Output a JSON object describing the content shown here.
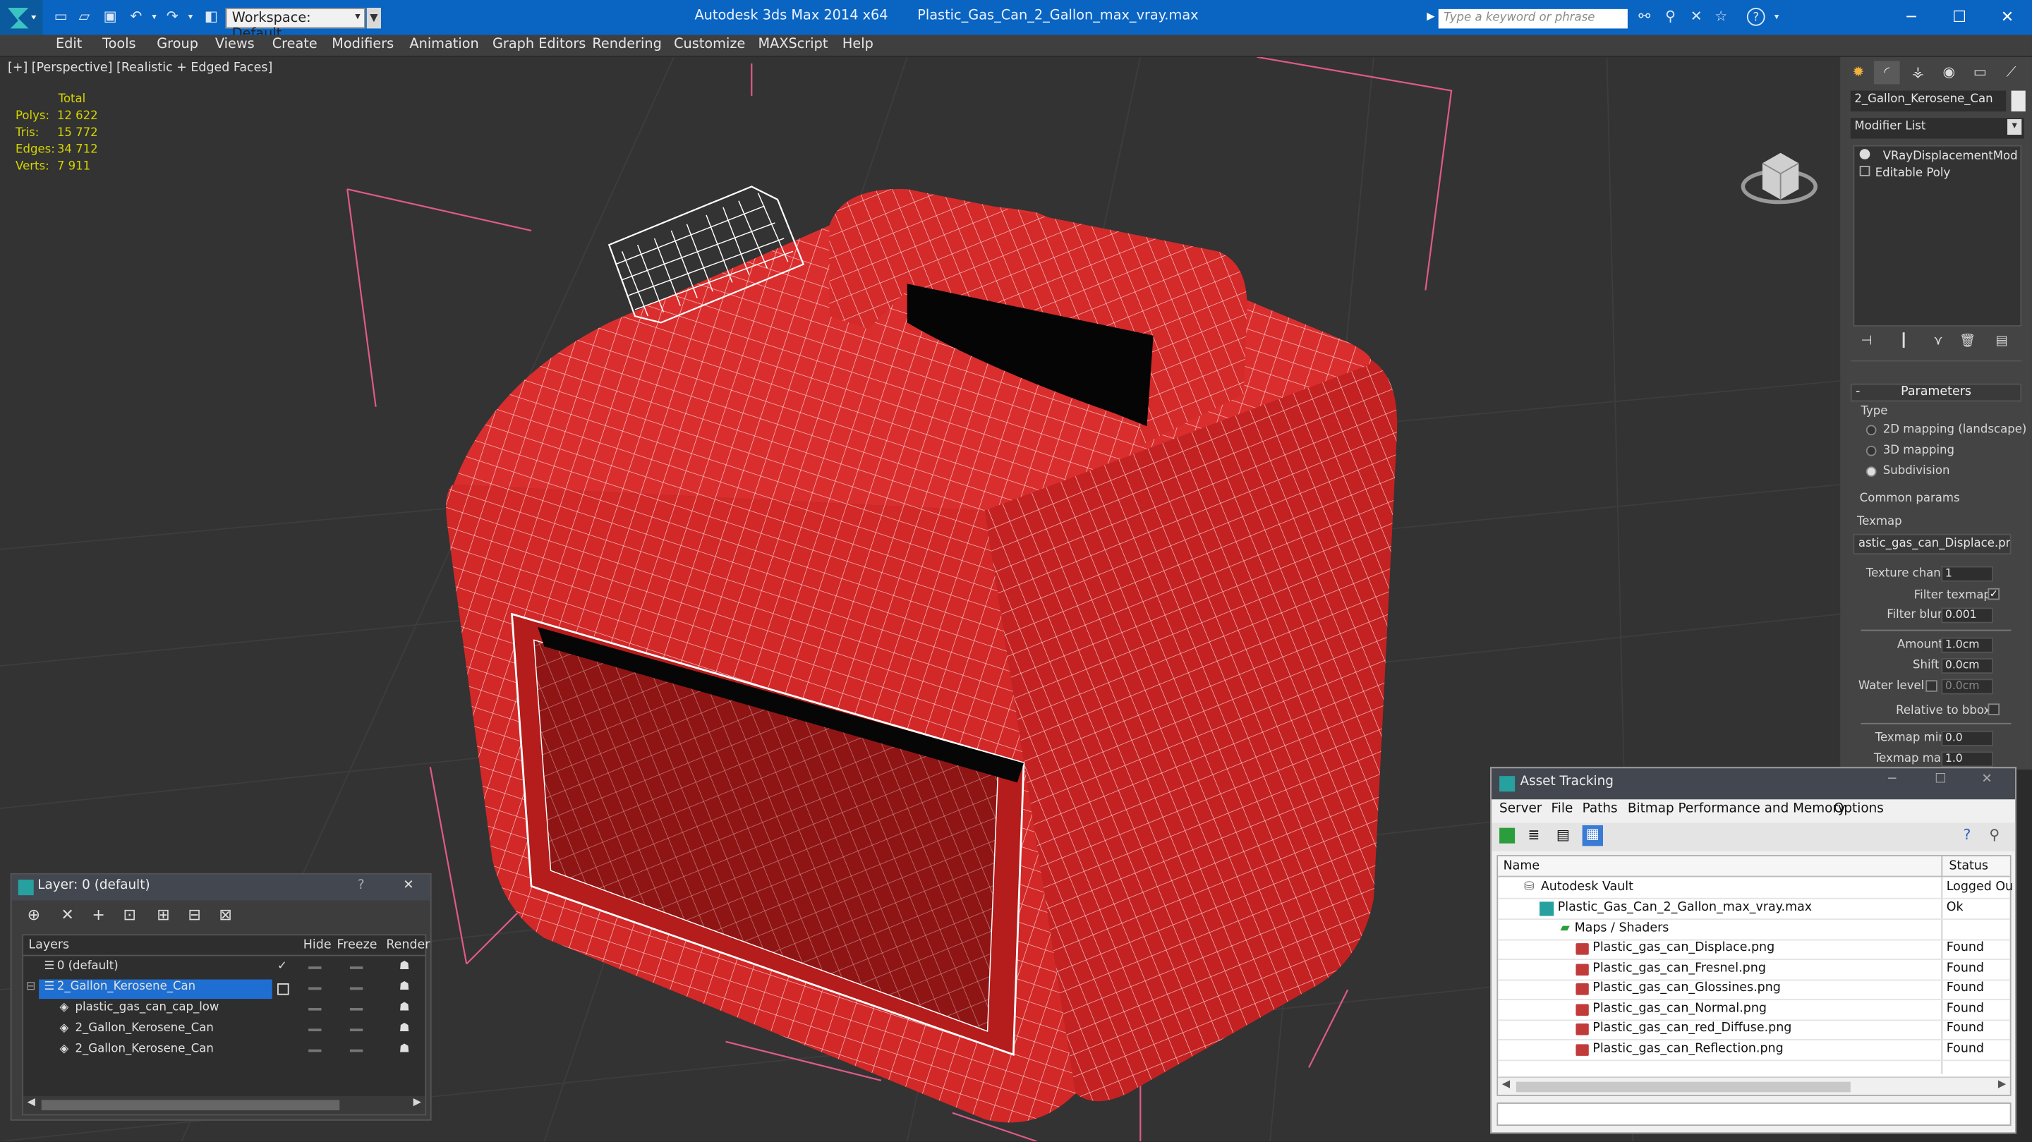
{
  "app": {
    "title": "Autodesk 3ds Max  2014 x64",
    "filename": "Plastic_Gas_Can_2_Gallon_max_vray.max",
    "workspace": "Workspace: Default",
    "search_placeholder": "Type a keyword or phrase"
  },
  "menu": [
    "Edit",
    "Tools",
    "Group",
    "Views",
    "Create",
    "Modifiers",
    "Animation",
    "Graph Editors",
    "Rendering",
    "Customize",
    "MAXScript",
    "Help"
  ],
  "viewport": {
    "label": "[+] [Perspective] [Realistic + Edged Faces]",
    "stats_header": "Total",
    "stats": [
      {
        "label": "Polys:",
        "value": "12 622"
      },
      {
        "label": "Tris:",
        "value": "15 772"
      },
      {
        "label": "Edges:",
        "value": "34 712"
      },
      {
        "label": "Verts:",
        "value": "7 911"
      }
    ]
  },
  "command_panel": {
    "object_name": "2_Gallon_Kerosene_Can",
    "modifier_list": "Modifier List",
    "stack": [
      "VRayDisplacementMod",
      "Editable Poly"
    ],
    "parameters_title": "Parameters",
    "type_label": "Type",
    "type_options": [
      "2D mapping (landscape)",
      "3D mapping",
      "Subdivision"
    ],
    "type_selected": 2,
    "common_params": "Common params",
    "texmap_label": "Texmap",
    "texmap_value": "astic_gas_can_Displace.png)",
    "texture_chan_label": "Texture chan",
    "texture_chan": "1",
    "filter_texmap_label": "Filter texmap",
    "filter_blur_label": "Filter blur",
    "filter_blur": "0.001",
    "amount_label": "Amount",
    "amount": "1.0cm",
    "shift_label": "Shift",
    "shift": "0.0cm",
    "water_level_label": "Water level",
    "water_level": "0.0cm",
    "relative_bbox_label": "Relative to bbox",
    "texmap_min_label": "Texmap min",
    "texmap_min": "0.0",
    "texmap_max_label": "Texmap max",
    "texmap_max": "1.0"
  },
  "layer_dialog": {
    "title": "Layer: 0 (default)",
    "help": "?",
    "close": "✕",
    "columns": [
      "Layers",
      "Hide",
      "Freeze",
      "Render"
    ],
    "rows": [
      {
        "name": "0 (default)",
        "indent": 0
      },
      {
        "name": "2_Gallon_Kerosene_Can",
        "indent": 0
      },
      {
        "name": "plastic_gas_can_cap_low",
        "indent": 1
      },
      {
        "name": "2_Gallon_Kerosene_Can",
        "indent": 1
      },
      {
        "name": "2_Gallon_Kerosene_Can",
        "indent": 1
      }
    ]
  },
  "asset_tracking": {
    "title": "Asset Tracking",
    "menu": [
      "Server",
      "File",
      "Paths",
      "Bitmap Performance and Memory",
      "Options"
    ],
    "columns": [
      "Name",
      "Status"
    ],
    "rows": [
      {
        "name": "Autodesk Vault",
        "status": "Logged Ou",
        "level": 0,
        "kind": "vault"
      },
      {
        "name": "Plastic_Gas_Can_2_Gallon_max_vray.max",
        "status": "Ok",
        "level": 1,
        "kind": "max"
      },
      {
        "name": "Maps / Shaders",
        "status": "",
        "level": 2,
        "kind": "folder"
      },
      {
        "name": "Plastic_gas_can_Displace.png",
        "status": "Found",
        "level": 3,
        "kind": "png"
      },
      {
        "name": "Plastic_gas_can_Fresnel.png",
        "status": "Found",
        "level": 3,
        "kind": "png"
      },
      {
        "name": "Plastic_gas_can_Glossines.png",
        "status": "Found",
        "level": 3,
        "kind": "png"
      },
      {
        "name": "Plastic_gas_can_Normal.png",
        "status": "Found",
        "level": 3,
        "kind": "png"
      },
      {
        "name": "Plastic_gas_can_red_Diffuse.png",
        "status": "Found",
        "level": 3,
        "kind": "png"
      },
      {
        "name": "Plastic_gas_can_Reflection.png",
        "status": "Found",
        "level": 3,
        "kind": "png"
      }
    ]
  },
  "colors": {
    "titlebar": "#0a64c2",
    "can_red": "#d42a2a",
    "selection": "#1e6fd1",
    "stats_yellow": "#d4d400"
  }
}
